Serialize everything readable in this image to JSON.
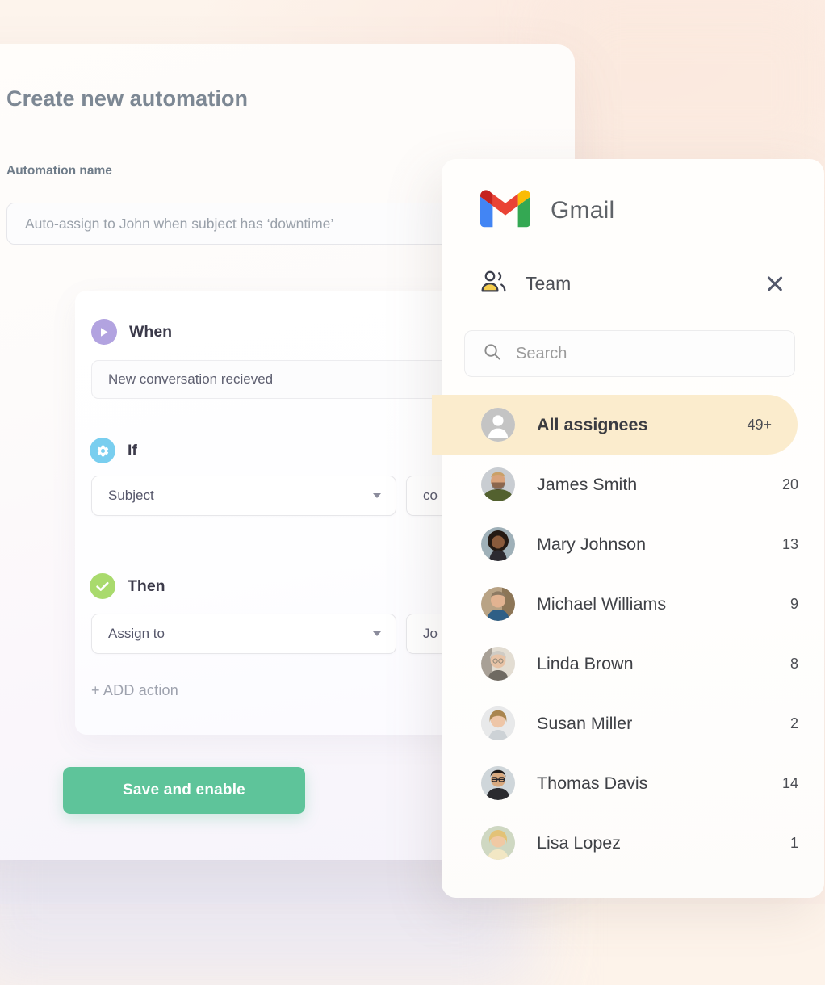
{
  "colors": {
    "page_background": "#fdf3ea",
    "accent_green": "#5ec49a",
    "badge_when": "#b2a3e0",
    "badge_if": "#79ceef",
    "badge_then": "#a9da6d",
    "selected_row": "#fbeccd"
  },
  "automation": {
    "title": "Create new automation",
    "name_field": {
      "label": "Automation name",
      "value": "",
      "placeholder": "Auto-assign to John when subject has ‘downtime’"
    },
    "steps": [
      {
        "title": "When",
        "badge_icon": "play-icon",
        "fields": [
          {
            "type": "readonly",
            "value": "New conversation recieved"
          }
        ]
      },
      {
        "title": "If",
        "badge_icon": "gear-icon",
        "fields": [
          {
            "type": "select",
            "value": "Subject"
          },
          {
            "type": "select",
            "value": "co"
          }
        ]
      },
      {
        "title": "Then",
        "badge_icon": "check-icon",
        "fields": [
          {
            "type": "select",
            "value": "Assign to"
          },
          {
            "type": "select",
            "value": "Jo"
          }
        ]
      }
    ],
    "add_action_label": "+ ADD action",
    "save_button_label": "Save and enable"
  },
  "gmail_panel": {
    "brand": "Gmail",
    "brand_icon": "gmail-logo-icon",
    "team": {
      "label": "Team",
      "icon": "people-group-icon",
      "close_icon": "close-icon"
    },
    "search": {
      "placeholder": "Search",
      "value": "",
      "icon": "search-icon"
    },
    "assignees": [
      {
        "name": "All assignees",
        "count": "49+",
        "selected": true,
        "avatar": "generic-person-icon"
      },
      {
        "name": "James Smith",
        "count": "20",
        "selected": false,
        "avatar": "photo-james-smith"
      },
      {
        "name": "Mary Johnson",
        "count": "13",
        "selected": false,
        "avatar": "photo-mary-johnson"
      },
      {
        "name": "Michael Williams",
        "count": "9",
        "selected": false,
        "avatar": "photo-michael-williams"
      },
      {
        "name": "Linda Brown",
        "count": "8",
        "selected": false,
        "avatar": "photo-linda-brown"
      },
      {
        "name": "Susan Miller",
        "count": "2",
        "selected": false,
        "avatar": "photo-susan-miller"
      },
      {
        "name": "Thomas Davis",
        "count": "14",
        "selected": false,
        "avatar": "photo-thomas-davis"
      },
      {
        "name": "Lisa Lopez",
        "count": "1",
        "selected": false,
        "avatar": "photo-lisa-lopez"
      }
    ]
  }
}
